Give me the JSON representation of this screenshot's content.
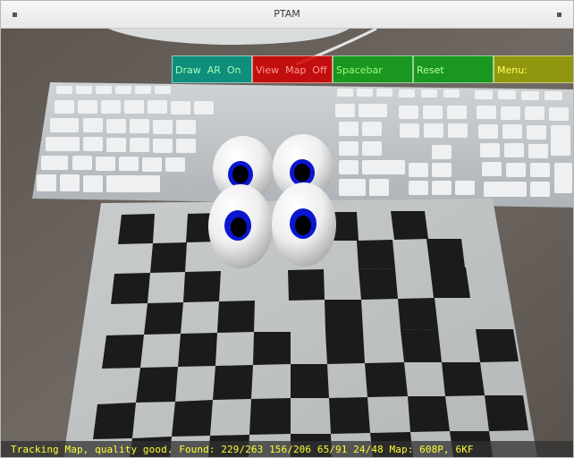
{
  "window": {
    "title": "PTAM"
  },
  "menu": {
    "draw_ar": "Draw  AR  On",
    "view_map": "View  Map  Off",
    "spacebar": "Spacebar",
    "reset": "Reset",
    "menu": "Menu:"
  },
  "status": {
    "text": "Tracking Map, quality good. Found: 229/263 156/206 65/91 24/48 Map: 608P, 6KF"
  },
  "colors": {
    "draw_ar_bg": "#009682",
    "view_map_bg": "#d20000",
    "spacebar_bg": "#0aa014",
    "reset_bg": "#0aa014",
    "menu_bg": "#96a000",
    "status_text": "#ffff33"
  },
  "icons": [
    "window-menu-icon",
    "window-close-icon"
  ]
}
